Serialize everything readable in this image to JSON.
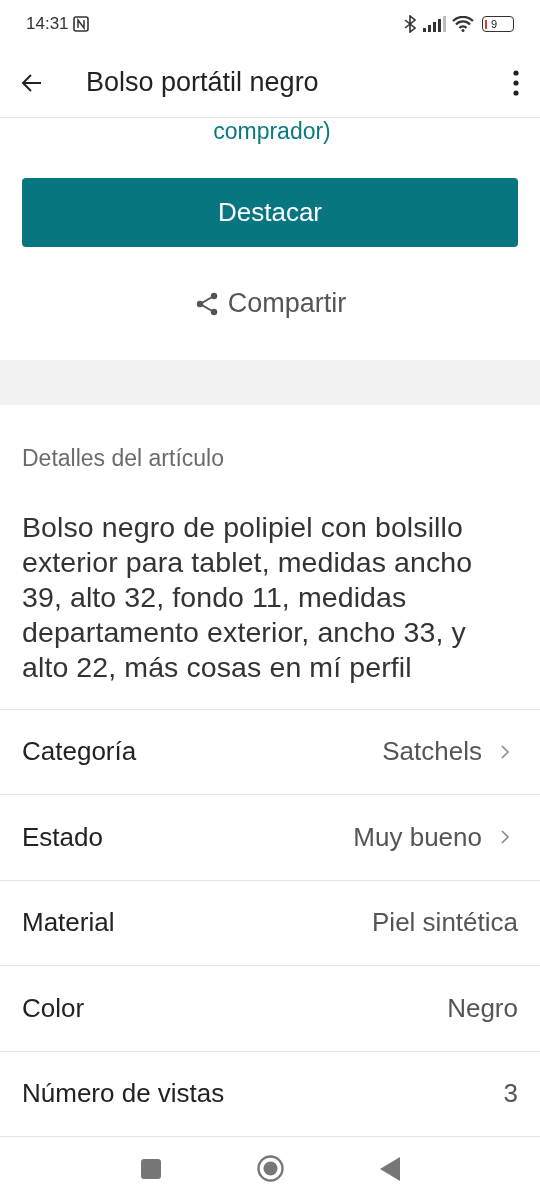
{
  "status_bar": {
    "time": "14:31",
    "battery": "9"
  },
  "app_bar": {
    "title": "Bolso portátil negro"
  },
  "partial_link": "comprador)",
  "primary_button": "Destacar",
  "share_button": "Compartir",
  "details": {
    "heading": "Detalles del artículo",
    "description": "Bolso negro de polipiel con bolsillo exterior para tablet, medidas ancho 39, alto 32, fondo 11, medidas departamento exterior, ancho 33, y alto 22, más cosas en mí perfil"
  },
  "attributes": [
    {
      "label": "Categoría",
      "value": "Satchels",
      "chevron": true
    },
    {
      "label": "Estado",
      "value": "Muy bueno",
      "chevron": true
    },
    {
      "label": "Material",
      "value": "Piel sintética",
      "chevron": false
    },
    {
      "label": "Color",
      "value": "Negro",
      "chevron": false
    },
    {
      "label": "Número de vistas",
      "value": "3",
      "chevron": false
    }
  ]
}
